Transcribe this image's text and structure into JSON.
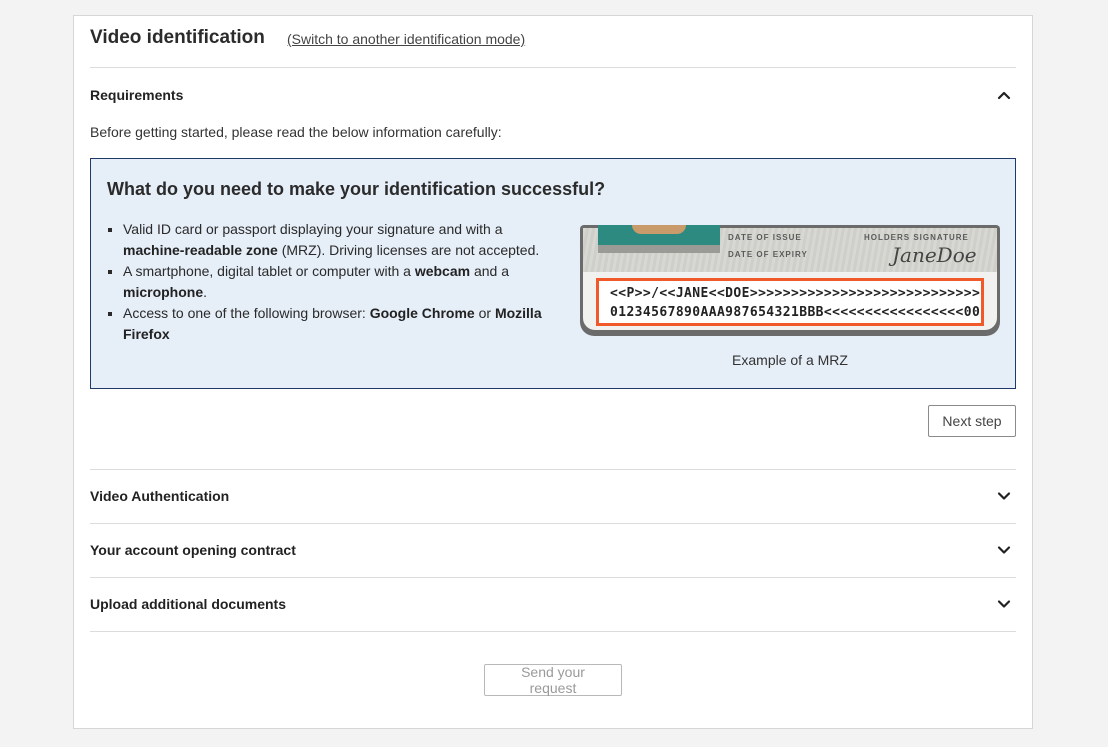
{
  "header": {
    "title": "Video identification",
    "switch_link": "(Switch to another identification mode)"
  },
  "requirements": {
    "label": "Requirements",
    "intro": "Before getting started, please read the below information carefully:",
    "box_title": "What do you need to make your identification successful?",
    "items": [
      {
        "t1": "Valid ID card or passport displaying your signature and with a ",
        "b1": "machine-readable zone",
        "t2": " (MRZ). Driving licenses are not accepted."
      },
      {
        "t1": "A smartphone, digital tablet or computer with a ",
        "b1": "webcam",
        "t2": " and a ",
        "b2": "microphone",
        "t3": "."
      },
      {
        "t1": "Access to one of the following browser: ",
        "b1": "Google Chrome",
        "t2": " or ",
        "b2": "Mozilla Firefox"
      }
    ],
    "mrz_card": {
      "date_of_issue": "DATE OF ISSUE",
      "date_of_expiry": "DATE OF EXPIRY",
      "holders_signature": "HOLDERS SIGNATURE",
      "signature": "JaneDoe",
      "line1": "<<P>>/<<JANE<<DOE>>>>>>>>>>>>>>>>>>>>>>>>>>>>",
      "line2": "01234567890AAA987654321BBB<<<<<<<<<<<<<<<<<00"
    },
    "mrz_caption": "Example of a MRZ",
    "next_button": "Next step"
  },
  "sections": [
    {
      "label": "Video Authentication"
    },
    {
      "label": "Your account opening contract"
    },
    {
      "label": "Upload additional documents"
    }
  ],
  "send_button": "Send your request",
  "colors": {
    "info_bg": "#e6eef8",
    "info_border": "#1f3a66",
    "mrz_highlight": "#f05a2a"
  }
}
